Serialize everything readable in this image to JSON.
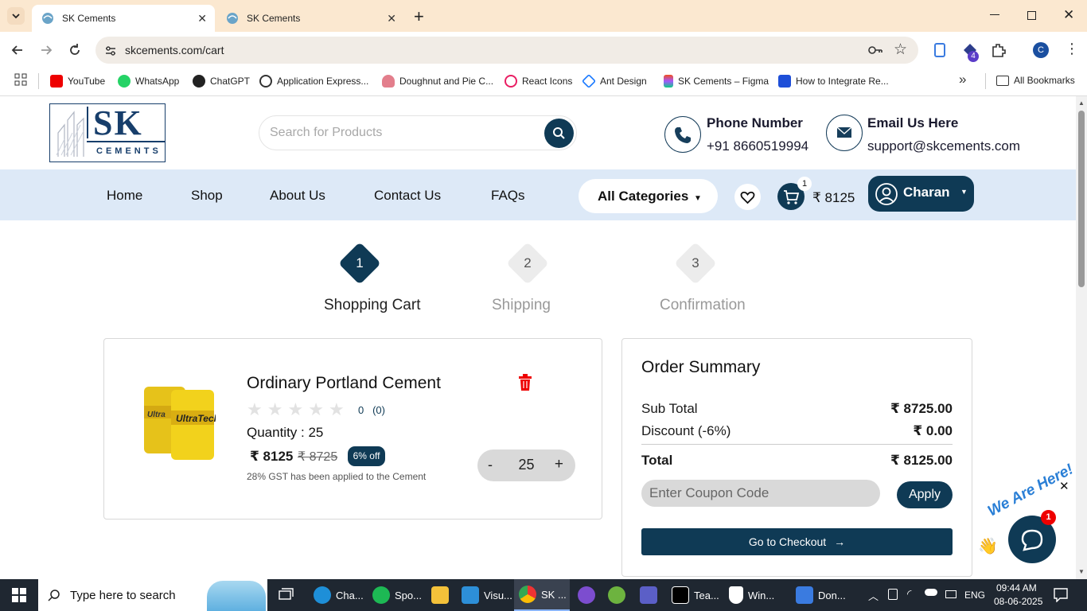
{
  "browser": {
    "tabs": [
      {
        "title": "SK Cements",
        "active": true
      },
      {
        "title": "SK Cements",
        "active": false
      }
    ],
    "url": "skcements.com/cart",
    "profile_initial": "C",
    "extension_badge": "4",
    "bookmarks": [
      {
        "label": "YouTube"
      },
      {
        "label": "WhatsApp"
      },
      {
        "label": "ChatGPT"
      },
      {
        "label": "Application Express..."
      },
      {
        "label": "Doughnut and Pie C..."
      },
      {
        "label": "React Icons"
      },
      {
        "label": "Ant Design"
      },
      {
        "label": "SK Cements – Figma"
      },
      {
        "label": "How to Integrate Re..."
      }
    ],
    "all_bookmarks": "All Bookmarks"
  },
  "site": {
    "logo_main": "SK",
    "logo_sub": "CEMENTS",
    "search_placeholder": "Search for Products",
    "phone_title": "Phone Number",
    "phone_value": "+91 8660519994",
    "email_title": "Email Us Here",
    "email_value": "support@skcements.com",
    "nav": [
      "Home",
      "Shop",
      "About Us",
      "Contact Us",
      "FAQs"
    ],
    "all_categories": "All Categories",
    "cart_count": "1",
    "cart_amount": "₹ 8125",
    "user_name": "Charan"
  },
  "steps": [
    {
      "num": "1",
      "label": "Shopping Cart",
      "active": true
    },
    {
      "num": "2",
      "label": "Shipping",
      "active": false
    },
    {
      "num": "3",
      "label": "Confirmation",
      "active": false
    }
  ],
  "cart_item": {
    "name": "Ordinary Portland Cement",
    "rating_value": "0",
    "rating_count": "(0)",
    "quantity_label": "Quantity : 25",
    "price": "₹ 8125",
    "mrp": "₹ 8725",
    "discount_badge": "6% off",
    "gst_note": "28% GST has been applied to the Cement",
    "qty": "25",
    "minus": "-",
    "plus": "+"
  },
  "order_summary": {
    "title": "Order Summary",
    "subtotal_label": "Sub Total",
    "subtotal_value": "₹ 8725.00",
    "discount_label": "Discount (-6%)",
    "discount_value": "₹ 0.00",
    "total_label": "Total",
    "total_value": "₹ 8125.00",
    "coupon_placeholder": "Enter Coupon Code",
    "apply_label": "Apply",
    "checkout_label": "Go to Checkout"
  },
  "chat_widget": {
    "tagline": "We Are Here!",
    "badge": "1"
  },
  "taskbar": {
    "search_placeholder": "Type here to search",
    "apps": [
      {
        "label": "Cha..."
      },
      {
        "label": "Spo..."
      },
      {
        "label": ""
      },
      {
        "label": "Visu..."
      },
      {
        "label": "SK ..."
      },
      {
        "label": ""
      },
      {
        "label": ""
      },
      {
        "label": ""
      },
      {
        "label": "Tea..."
      },
      {
        "label": "Win..."
      },
      {
        "label": "Don..."
      }
    ],
    "language": "ENG",
    "time": "09:44 AM",
    "date": "08-06-2025"
  },
  "colors": {
    "brand": "#0f3a55",
    "nav_bg": "#dde9f7",
    "delete_icon": "#e00000",
    "tabstrip_bg": "#fbe8d0"
  }
}
